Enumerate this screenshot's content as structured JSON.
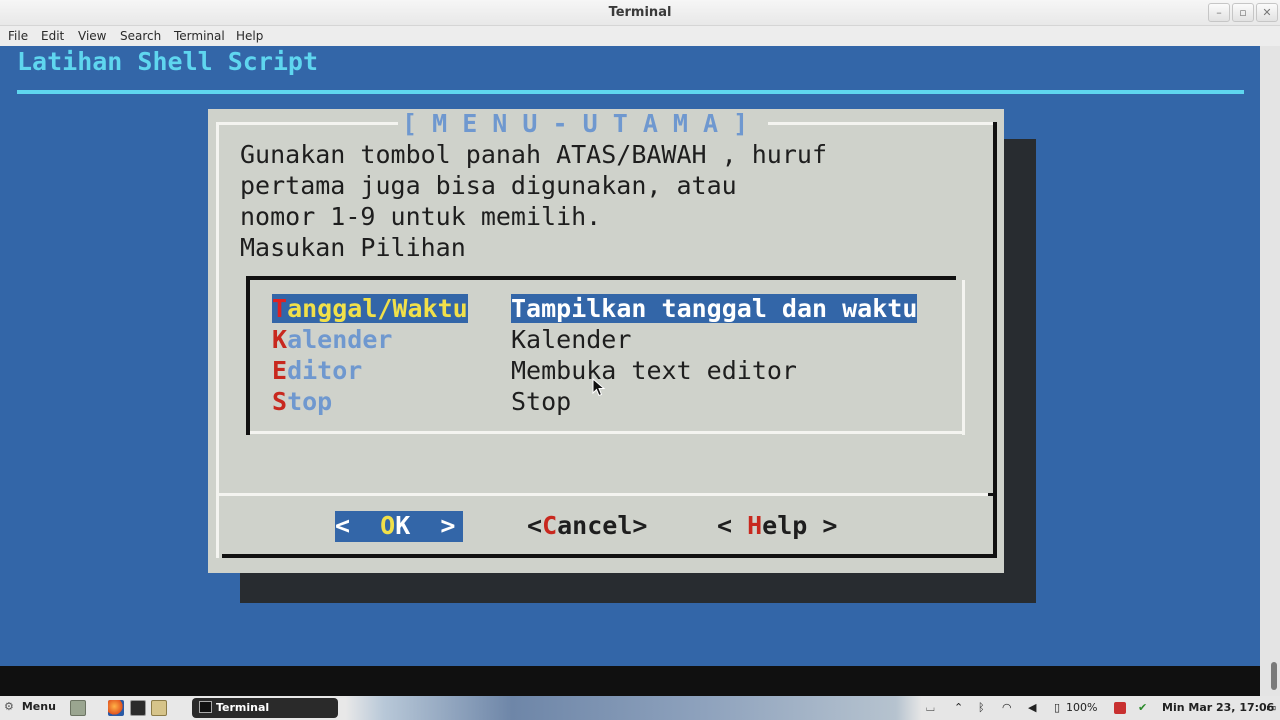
{
  "window": {
    "title": "Terminal",
    "minimize": "–",
    "maximize": "▫",
    "close": "✕"
  },
  "menubar": {
    "file": "File",
    "edit": "Edit",
    "view": "View",
    "search": "Search",
    "terminal": "Terminal",
    "help": "Help"
  },
  "backtitle": "Latihan Shell Script",
  "dialog": {
    "title": "[ M E N U - U T A M A ]",
    "text": [
      "Gunakan tombol panah ATAS/BAWAH , huruf",
      "pertama juga bisa digunakan, atau",
      "nomor 1-9 untuk memilih.",
      "Masukan Pilihan"
    ],
    "items": [
      {
        "hot": "T",
        "rest": "anggal/Waktu",
        "desc": "Tampilkan tanggal dan waktu"
      },
      {
        "hot": "K",
        "rest": "alender",
        "desc": "Kalender"
      },
      {
        "hot": "E",
        "rest": "ditor",
        "desc": "Membuka text editor"
      },
      {
        "hot": "S",
        "rest": "top",
        "desc": "Stop"
      }
    ],
    "selected_index": 0,
    "buttons": {
      "ok": {
        "pre": "<  ",
        "hot": "O",
        "rest": "K",
        "post": "  >"
      },
      "cancel": {
        "pre": "<",
        "hot": "C",
        "rest": "ancel",
        "post": ">"
      },
      "help": {
        "pre": "< ",
        "hot": "H",
        "rest": "elp",
        "post": " >"
      }
    }
  },
  "taskbar": {
    "menu_label": "Menu",
    "task_label": "Terminal",
    "battery": "100%",
    "clock": "Min Mar 23, 17:06"
  },
  "colors": {
    "terminal_bg": "#3366a8",
    "dialog_bg": "#cfd2cb",
    "accent_cyan": "#5fd6ef",
    "hotkey_red": "#c8281e",
    "highlight_yellow": "#f1e04a"
  }
}
